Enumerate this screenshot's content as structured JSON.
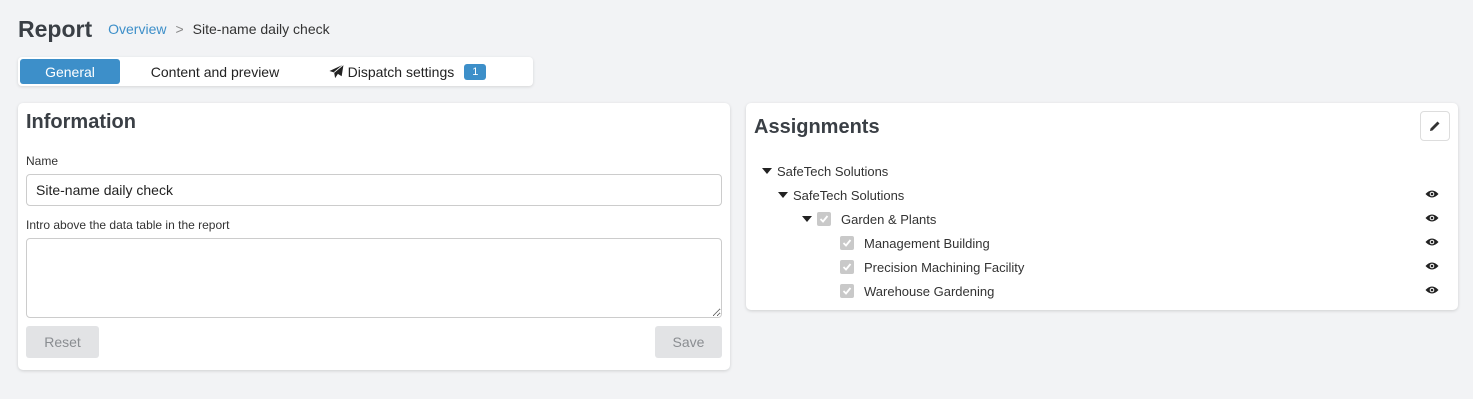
{
  "header": {
    "title": "Report",
    "breadcrumb": {
      "link": "Overview",
      "separator": ">",
      "current": "Site-name daily check"
    }
  },
  "tabs": [
    {
      "label": "General",
      "active": true
    },
    {
      "label": "Content and preview",
      "active": false
    },
    {
      "label": "Dispatch settings",
      "active": false,
      "icon": "paper-plane-icon",
      "badge": "1"
    }
  ],
  "information": {
    "title": "Information",
    "name_label": "Name",
    "name_value": "Site-name daily check",
    "intro_label": "Intro above the data table in the report",
    "intro_value": "",
    "reset_label": "Reset",
    "save_label": "Save"
  },
  "assignments": {
    "title": "Assignments",
    "edit_icon": "pencil-icon",
    "tree": [
      {
        "label": "SafeTech Solutions",
        "level": 0,
        "expanded": true,
        "checkbox": false,
        "eye": false
      },
      {
        "label": "SafeTech Solutions",
        "level": 1,
        "expanded": true,
        "checkbox": false,
        "eye": true
      },
      {
        "label": "Garden & Plants",
        "level": 2,
        "expanded": true,
        "checkbox": true,
        "checked": true,
        "eye": true
      },
      {
        "label": "Management Building",
        "level": 3,
        "checkbox": true,
        "checked": true,
        "eye": true
      },
      {
        "label": "Precision Machining Facility",
        "level": 3,
        "checkbox": true,
        "checked": true,
        "eye": true
      },
      {
        "label": "Warehouse Gardening",
        "level": 3,
        "checkbox": true,
        "checked": true,
        "eye": true
      }
    ]
  },
  "colors": {
    "accent": "#3d8fc9",
    "background": "#f2f3f5",
    "disabled_button": "#e2e3e5"
  }
}
